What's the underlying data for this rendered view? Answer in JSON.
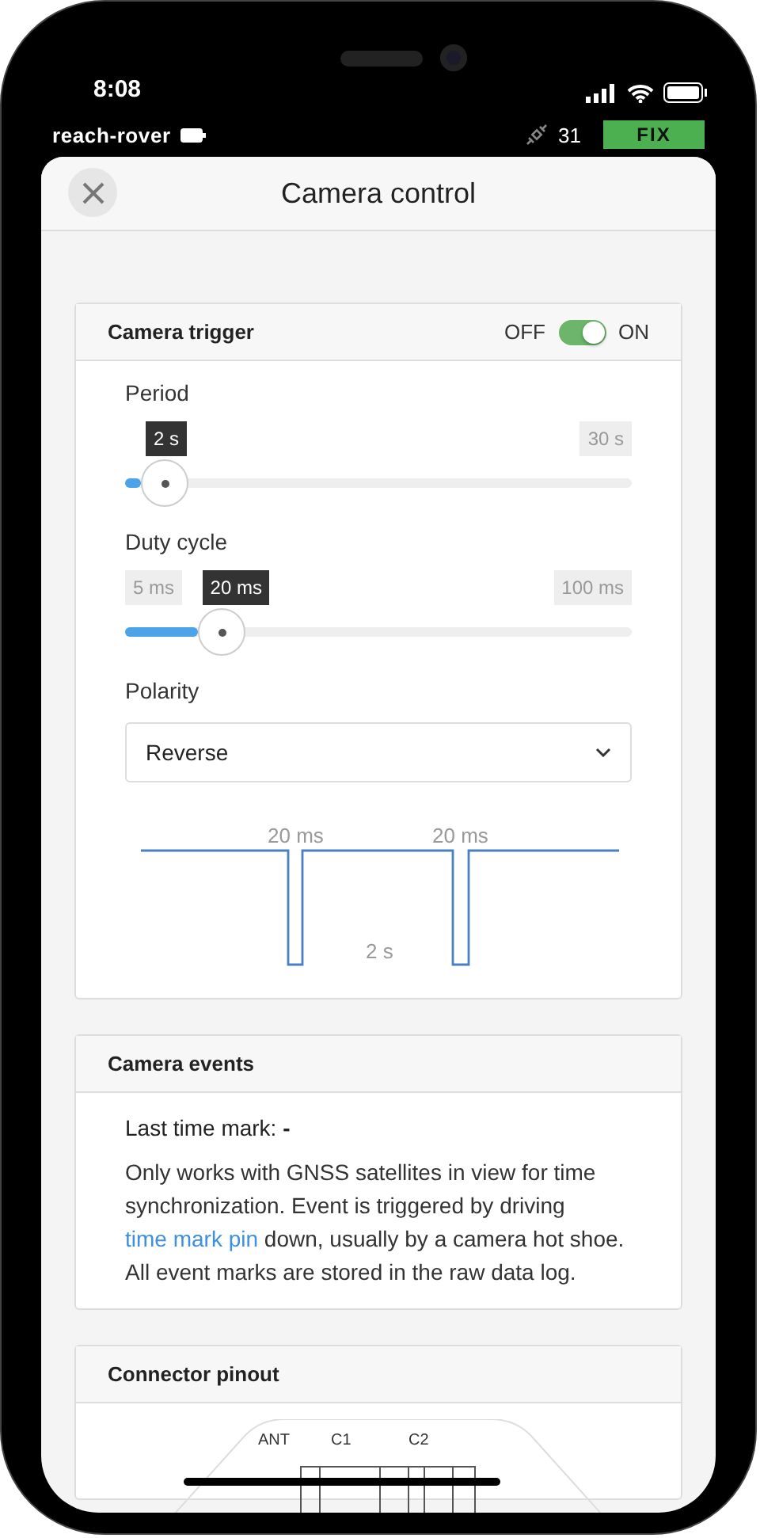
{
  "status_bar": {
    "time": "8:08"
  },
  "app_bar": {
    "device": "reach-rover",
    "satellites": "31",
    "fix": "FIX"
  },
  "header": {
    "title": "Camera control"
  },
  "camera_trigger": {
    "title": "Camera trigger",
    "toggle": {
      "off_label": "OFF",
      "on_label": "ON",
      "on": true
    },
    "sliders": [
      {
        "label": "Period",
        "value_label": "2 s",
        "max_label": "30 s",
        "level": 0.078
      },
      {
        "label": "Duty cycle",
        "min_label": "5 ms",
        "value_label": "20 ms",
        "max_label": "100 ms",
        "level": 0.19
      }
    ],
    "polarity": {
      "label": "Polarity",
      "value": "Reverse"
    },
    "diagram": {
      "pulse_labels": [
        "20 ms",
        "20 ms"
      ],
      "period_label": "2 s"
    }
  },
  "camera_events": {
    "title": "Camera events",
    "last_mark_label": "Last time mark:",
    "last_mark_value": "-",
    "text_before": "Only works with GNSS satellites in view for time synchronization. Event is triggered by driving ",
    "link": "time mark pin",
    "text_after": " down, usually by a camera hot shoe. All event marks are stored in the raw data log."
  },
  "connector_pinout": {
    "title": "Connector pinout",
    "pins": [
      "ANT",
      "C1",
      "C2"
    ]
  }
}
